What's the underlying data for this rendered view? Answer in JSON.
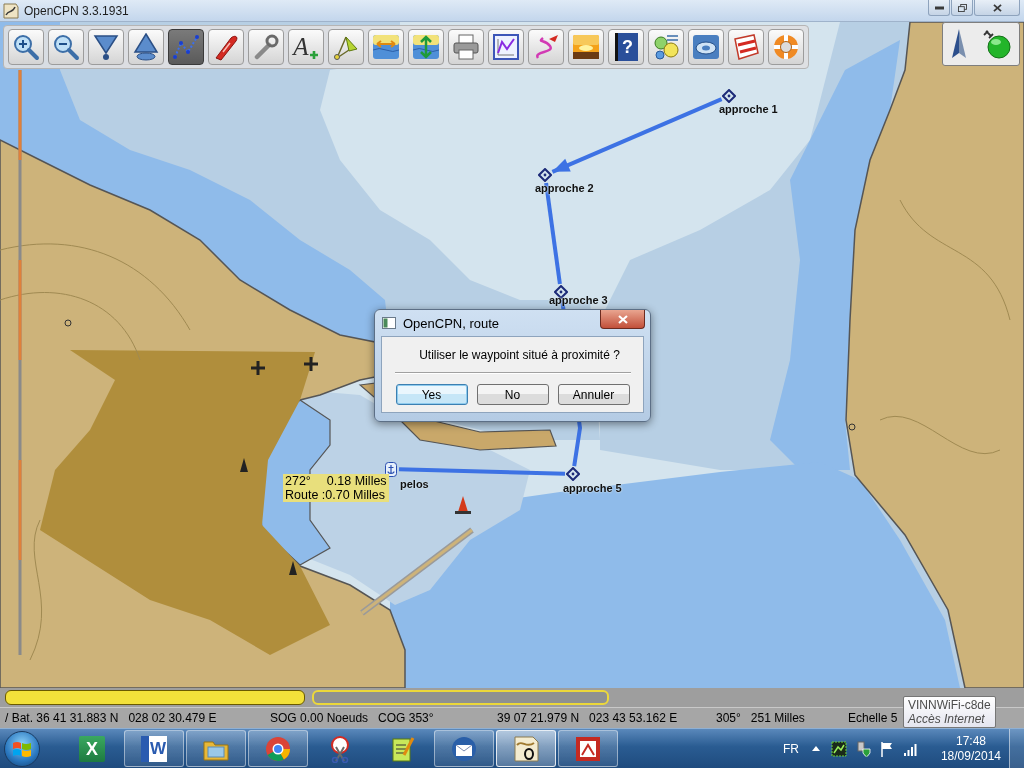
{
  "window": {
    "title": "OpenCPN 3.3.1931"
  },
  "toolbar": {
    "tools": [
      {
        "kind": "zoomin",
        "selected": false
      },
      {
        "kind": "zoomout",
        "selected": false
      },
      {
        "kind": "scaledown",
        "selected": false
      },
      {
        "kind": "scaleup",
        "selected": false
      },
      {
        "kind": "route",
        "selected": true
      },
      {
        "kind": "boat",
        "selected": false
      },
      {
        "kind": "settings",
        "selected": false
      },
      {
        "kind": "text",
        "glyph": "A",
        "selected": false
      },
      {
        "kind": "mark",
        "selected": false
      },
      {
        "kind": "tide",
        "selected": false
      },
      {
        "kind": "current",
        "selected": false
      },
      {
        "kind": "print",
        "selected": false
      },
      {
        "kind": "manager",
        "selected": false
      },
      {
        "kind": "track",
        "selected": false
      },
      {
        "kind": "dusk",
        "selected": false
      },
      {
        "kind": "help",
        "glyph": "?",
        "selected": false
      },
      {
        "kind": "ais",
        "selected": false
      },
      {
        "kind": "plugin",
        "selected": false
      },
      {
        "kind": "sign",
        "selected": false
      },
      {
        "kind": "lifebuoy",
        "selected": false
      }
    ]
  },
  "chart": {
    "waypoints": [
      {
        "kind": "diamond",
        "name": "approche 1"
      },
      {
        "kind": "diamond",
        "name": "approche 2"
      },
      {
        "kind": "diamond",
        "name": "approche 3"
      },
      {
        "kind": "diamond",
        "name": "approche 5"
      },
      {
        "kind": "anchor",
        "name": "pelos"
      }
    ],
    "route_tooltip": {
      "bearing": "272°",
      "distance": "0.18 Milles",
      "total": "Route :0.70 Milles"
    }
  },
  "dialog": {
    "title": "OpenCPN, route",
    "message": "Utiliser le waypoint situé à proximité ?",
    "buttons": [
      {
        "label": "Yes",
        "default": true
      },
      {
        "label": "No",
        "default": false
      },
      {
        "label": "Annuler",
        "default": false
      }
    ]
  },
  "chart_bar": {
    "keys": [
      {
        "selected": true
      },
      {
        "selected": false
      }
    ]
  },
  "status_bar": {
    "fields": [
      {
        "parts": [
          "/ Bat. 36 41 31.883 N",
          "028 02 30.479 E"
        ]
      },
      {
        "parts": [
          "SOG 0.00 Noeuds",
          "COG 353°"
        ]
      },
      {
        "parts": [
          "39 07 21.979 N",
          "023 43 53.162 E"
        ]
      },
      {
        "parts": [
          "305°",
          "251 Milles"
        ]
      },
      {
        "parts": [
          "Echelle 5"
        ]
      }
    ]
  },
  "network_tooltip": {
    "title": "VINNWiFi-c8de",
    "subtitle": "Accès Internet"
  },
  "taskbar": {
    "apps": [
      {
        "kind": "excel",
        "glyph": "X",
        "running": false,
        "selected": false
      },
      {
        "kind": "word",
        "glyph": "W",
        "running": true,
        "selected": false
      },
      {
        "kind": "explorer",
        "running": true,
        "selected": false
      },
      {
        "kind": "chrome",
        "running": true,
        "selected": false
      },
      {
        "kind": "snipping",
        "running": false,
        "selected": false
      },
      {
        "kind": "notepad",
        "running": false,
        "selected": false
      },
      {
        "kind": "thunderbird",
        "running": true,
        "selected": false
      },
      {
        "kind": "opencpn",
        "running": true,
        "selected": true
      },
      {
        "kind": "pdf",
        "running": true,
        "selected": false
      }
    ],
    "language": "FR",
    "time": "17:48",
    "date": "18/09/2014"
  }
}
